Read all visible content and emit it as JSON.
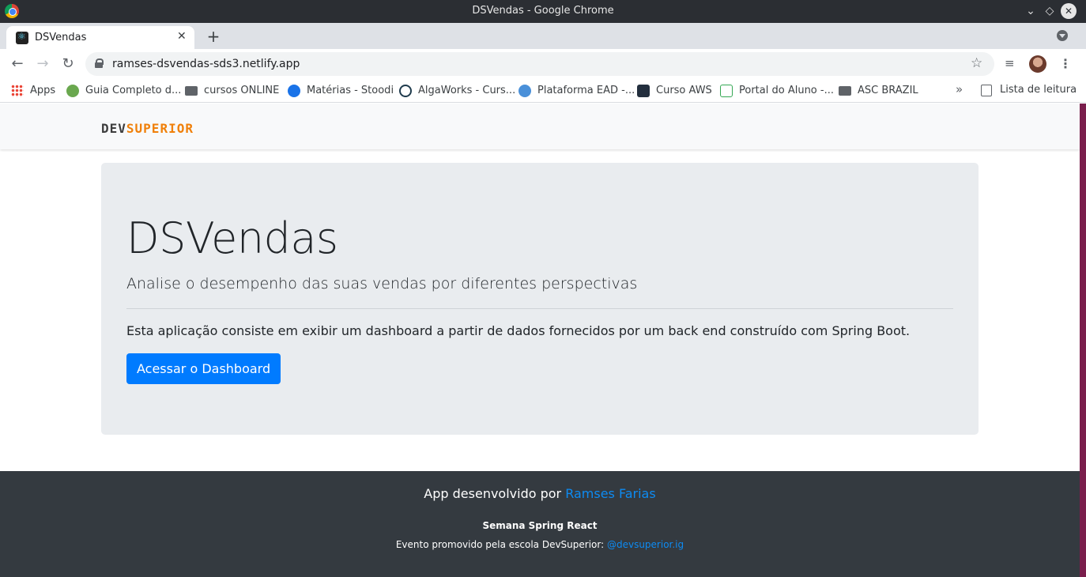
{
  "window": {
    "title": "DSVendas - Google Chrome",
    "controls": {
      "minimize": "⌄",
      "maximize": "◇",
      "close": "✕"
    }
  },
  "tabs": [
    {
      "title": "DSVendas",
      "active": true,
      "close": "✕",
      "icon": "react-icon"
    }
  ],
  "tabstrip": {
    "new_tab": "+",
    "tab_search_icon": "chevron-down-circle-icon"
  },
  "toolbar": {
    "back": "←",
    "forward": "→",
    "reload": "↻",
    "url": "ramses-dsvendas-sds3.netlify.app",
    "bookmark_star": "☆",
    "media_icon": "≡",
    "menu": "⋮"
  },
  "bookmarks": {
    "items": [
      {
        "label": "Apps",
        "icon": "apps-grid-icon"
      },
      {
        "label": "Guia Completo d...",
        "icon": "green-bookmark-icon"
      },
      {
        "label": "cursos ONLINE",
        "icon": "folder-icon"
      },
      {
        "label": "Matérias - Stoodi",
        "icon": "stoodi-icon"
      },
      {
        "label": "AlgaWorks - Curs...",
        "icon": "algaworks-icon"
      },
      {
        "label": "Plataforma EAD -...",
        "icon": "ead-icon"
      },
      {
        "label": "Curso AWS",
        "icon": "aws-icon"
      },
      {
        "label": "Portal do Aluno -...",
        "icon": "portal-icon"
      },
      {
        "label": "ASC BRAZIL",
        "icon": "folder-icon"
      }
    ],
    "more": "»",
    "reading_list": "Lista de leitura"
  },
  "site": {
    "logo_dev": "DEV",
    "logo_superior": "SUPERIOR",
    "hero": {
      "title": "DSVendas",
      "lead": "Analise o desempenho das suas vendas por diferentes perspectivas",
      "text": "Esta aplicação consiste em exibir um dashboard a partir de dados fornecidos por um back end construído com Spring Boot.",
      "button": "Acessar o Dashboard"
    },
    "footer": {
      "line1_prefix": "App desenvolvido por ",
      "author": "Ramses Farias",
      "event": "Semana Spring React",
      "line3_prefix": "Evento promovido pela escola DevSuperior: ",
      "handle": "@devsuperior.ig"
    }
  },
  "colors": {
    "accent": "#007bff",
    "logo_orange": "#f0800a",
    "footer_bg": "#343a40",
    "jumbotron_bg": "#e9ecef"
  }
}
